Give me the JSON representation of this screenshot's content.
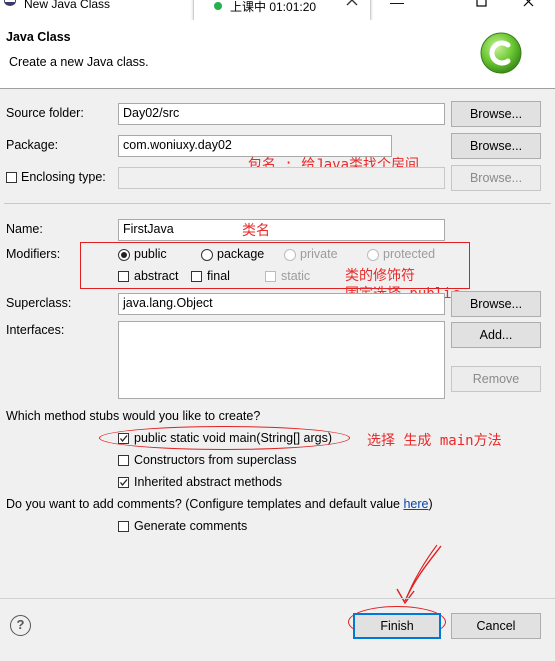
{
  "window": {
    "title": "New Java Class"
  },
  "meeting": {
    "text": "上课中 01:01:20"
  },
  "header": {
    "title": "Java Class",
    "subtitle": "Create a new Java class."
  },
  "form": {
    "source_folder": {
      "label": "Source folder:",
      "value": "Day02/src",
      "browse": "Browse..."
    },
    "package": {
      "label": "Package:",
      "value": "com.woniuxy.day02",
      "browse": "Browse..."
    },
    "enclosing": {
      "label": "Enclosing type:",
      "value": "",
      "browse": "Browse..."
    },
    "name": {
      "label": "Name:",
      "value": "FirstJava"
    },
    "modifiers": {
      "label": "Modifiers:",
      "public": "public",
      "package": "package",
      "private": "private",
      "protected": "protected",
      "abstract": "abstract",
      "final": "final",
      "static": "static",
      "selected": "public"
    },
    "superclass": {
      "label": "Superclass:",
      "value": "java.lang.Object",
      "browse": "Browse..."
    },
    "interfaces": {
      "label": "Interfaces:",
      "add": "Add...",
      "remove": "Remove"
    }
  },
  "stubs": {
    "question": "Which method stubs would you like to create?",
    "main": {
      "label": "public static void main(String[] args)",
      "checked": true
    },
    "constructors": {
      "label": "Constructors from superclass",
      "checked": false
    },
    "inherited": {
      "label": "Inherited abstract methods",
      "checked": true
    }
  },
  "comments": {
    "question": "Do you want to add comments? (Configure templates and default value ",
    "link": "here",
    "suffix": ")",
    "generate": {
      "label": "Generate comments",
      "checked": false
    }
  },
  "footer": {
    "finish": "Finish",
    "cancel": "Cancel",
    "help_icon": "?"
  },
  "annotations": {
    "package": "包名 : 给Java类找个房间",
    "name": "类名",
    "modifiers_1": "类的修饰符",
    "modifiers_2": "固定选择-public",
    "main": "选择 生成 main方法"
  },
  "colors": {
    "annotation": "#e82a2a",
    "link": "#0645ad",
    "logo": "#5bbf2a"
  }
}
